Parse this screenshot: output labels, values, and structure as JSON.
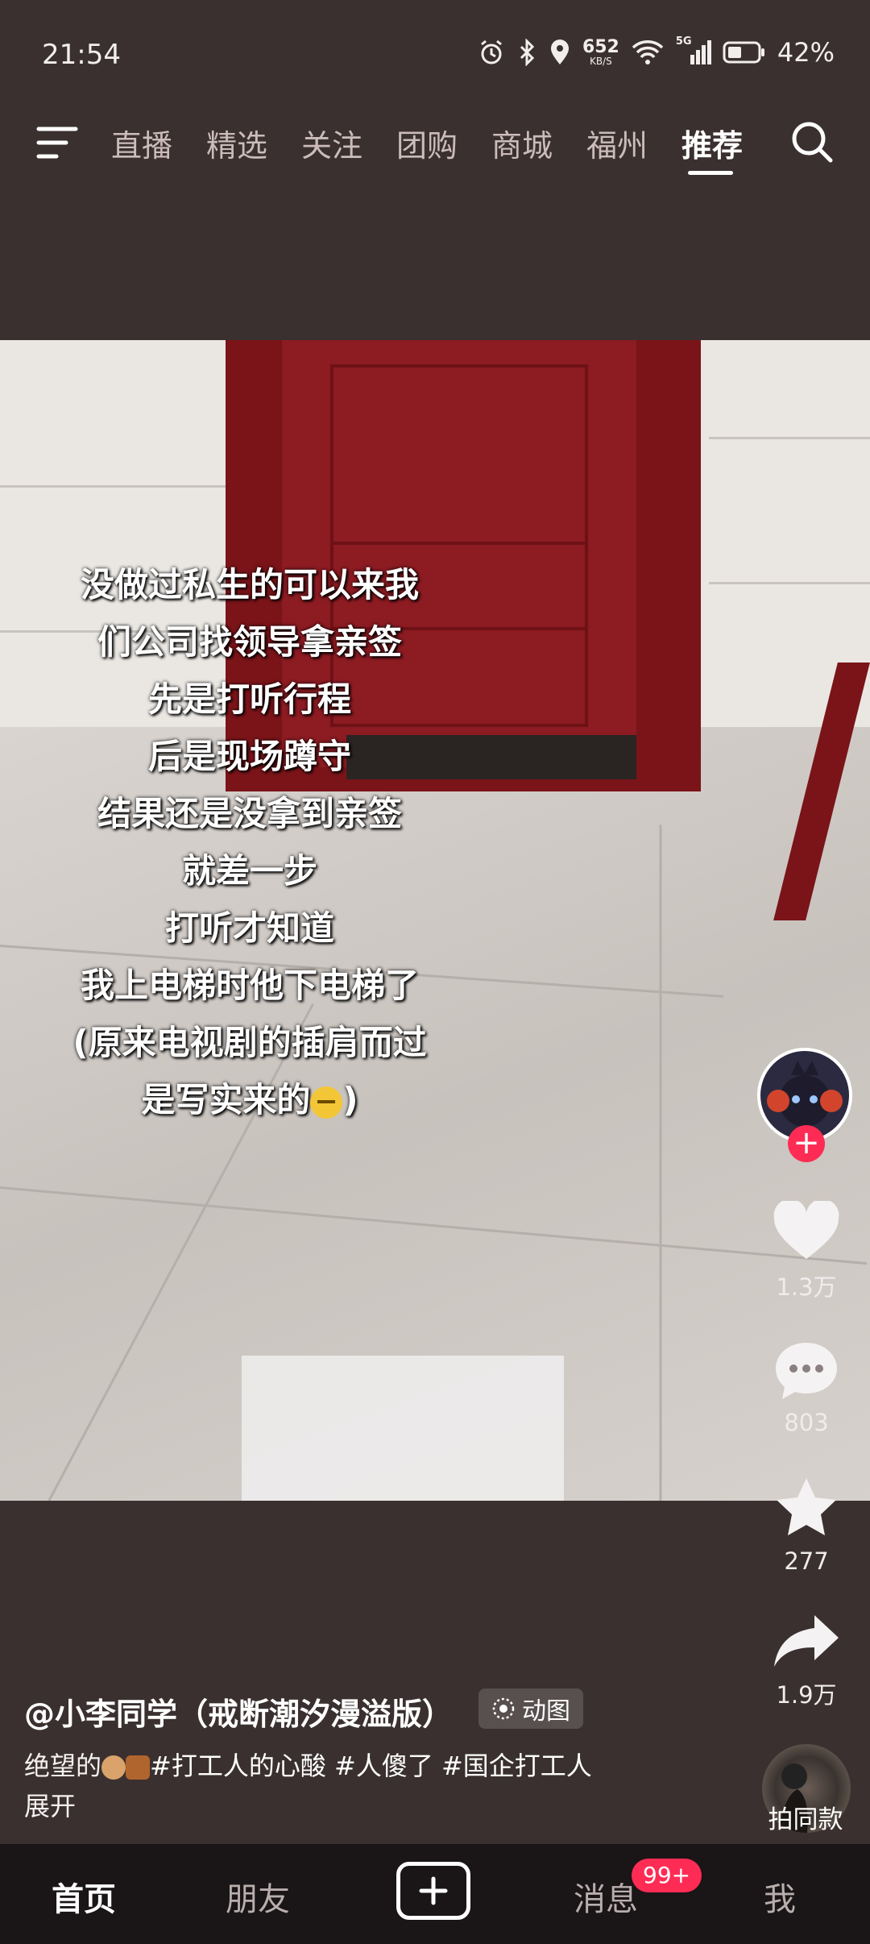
{
  "status_bar": {
    "time": "21:54",
    "net_speed": "652",
    "net_unit": "KB/S",
    "signal_label": "5G",
    "battery_percent": "42%"
  },
  "top_nav": {
    "tabs": [
      "直播",
      "精选",
      "关注",
      "团购",
      "商城",
      "福州",
      "推荐"
    ],
    "active_tab": "推荐"
  },
  "video": {
    "caption_lines": [
      "没做过私生的可以来我",
      "们公司找领导拿亲签",
      "先是打听行程",
      "后是现场蹲守",
      "结果还是没拿到亲签",
      "就差一步",
      "打听才知道",
      "我上电梯时他下电梯了",
      "(原来电视剧的插肩而过",
      "是写实来的"
    ],
    "caption_tail": ")"
  },
  "side_actions": {
    "likes": "1.3万",
    "comments": "803",
    "favorites": "277",
    "shares": "1.9万"
  },
  "post": {
    "author": "@小李同学（戒断潮汐漫溢版）",
    "badge_label": "动图",
    "desc_prefix": "绝望的",
    "hashtags": "#打工人的心酸 #人傻了 #国企打工人",
    "expand_label": "展开",
    "music_label": "拍同款"
  },
  "bottom_nav": {
    "home": "首页",
    "friends": "朋友",
    "messages": "消息",
    "messages_badge": "99+",
    "me": "我"
  },
  "colors": {
    "background": "#3a302f",
    "accent": "#fe2c55",
    "door": "#8c1b22"
  }
}
